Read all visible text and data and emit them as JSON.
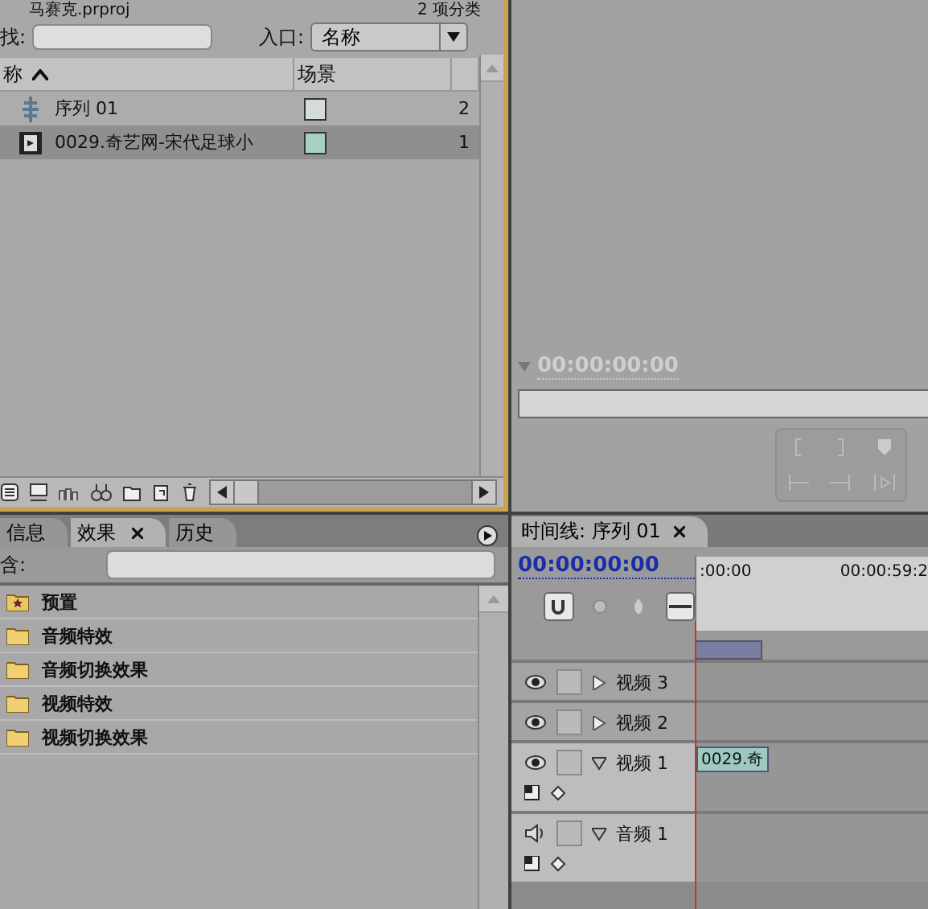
{
  "project": {
    "title": "马赛克.prproj",
    "count": "2 项分类",
    "search_label": "找:",
    "entry_label": "入口:",
    "entry_value": "名称",
    "columns": [
      {
        "label": "称",
        "sorted": true
      },
      {
        "label": "场景",
        "sorted": false
      }
    ],
    "items": [
      {
        "kind": "sequence",
        "name": "序列 01",
        "color": "#d3dcdb",
        "column_3": "2",
        "selected": false
      },
      {
        "kind": "clip",
        "name": "0029.奇艺网-宋代足球小",
        "color": "#a6cfc6",
        "column_3": "1",
        "selected": true
      }
    ]
  },
  "monitor": {
    "timecode": "00:00:00:00"
  },
  "effects": {
    "tabs": [
      {
        "label": "信息",
        "selected": false,
        "closable": false
      },
      {
        "label": "效果",
        "selected": true,
        "closable": true
      },
      {
        "label": "历史",
        "selected": false,
        "closable": false
      }
    ],
    "search_label": "含:",
    "folders": [
      {
        "kind": "presets",
        "label": "预置"
      },
      {
        "kind": "folder",
        "label": "音频特效"
      },
      {
        "kind": "folder",
        "label": "音频切换效果"
      },
      {
        "kind": "folder",
        "label": "视频特效"
      },
      {
        "kind": "folder",
        "label": "视频切换效果"
      }
    ]
  },
  "timeline": {
    "tab": "时间线: 序列 01",
    "closable": true,
    "timecode": "00:00:00:00",
    "ruler": [
      ":00:00",
      "00:00:59:2"
    ],
    "tracks": [
      {
        "kind": "video",
        "label": "视频 3",
        "expanded": false
      },
      {
        "kind": "video",
        "label": "视频 2",
        "expanded": false
      },
      {
        "kind": "video",
        "label": "视频 1",
        "expanded": true,
        "clip": "0029.奇"
      },
      {
        "kind": "audio",
        "label": "音频 1",
        "expanded": true
      }
    ]
  }
}
